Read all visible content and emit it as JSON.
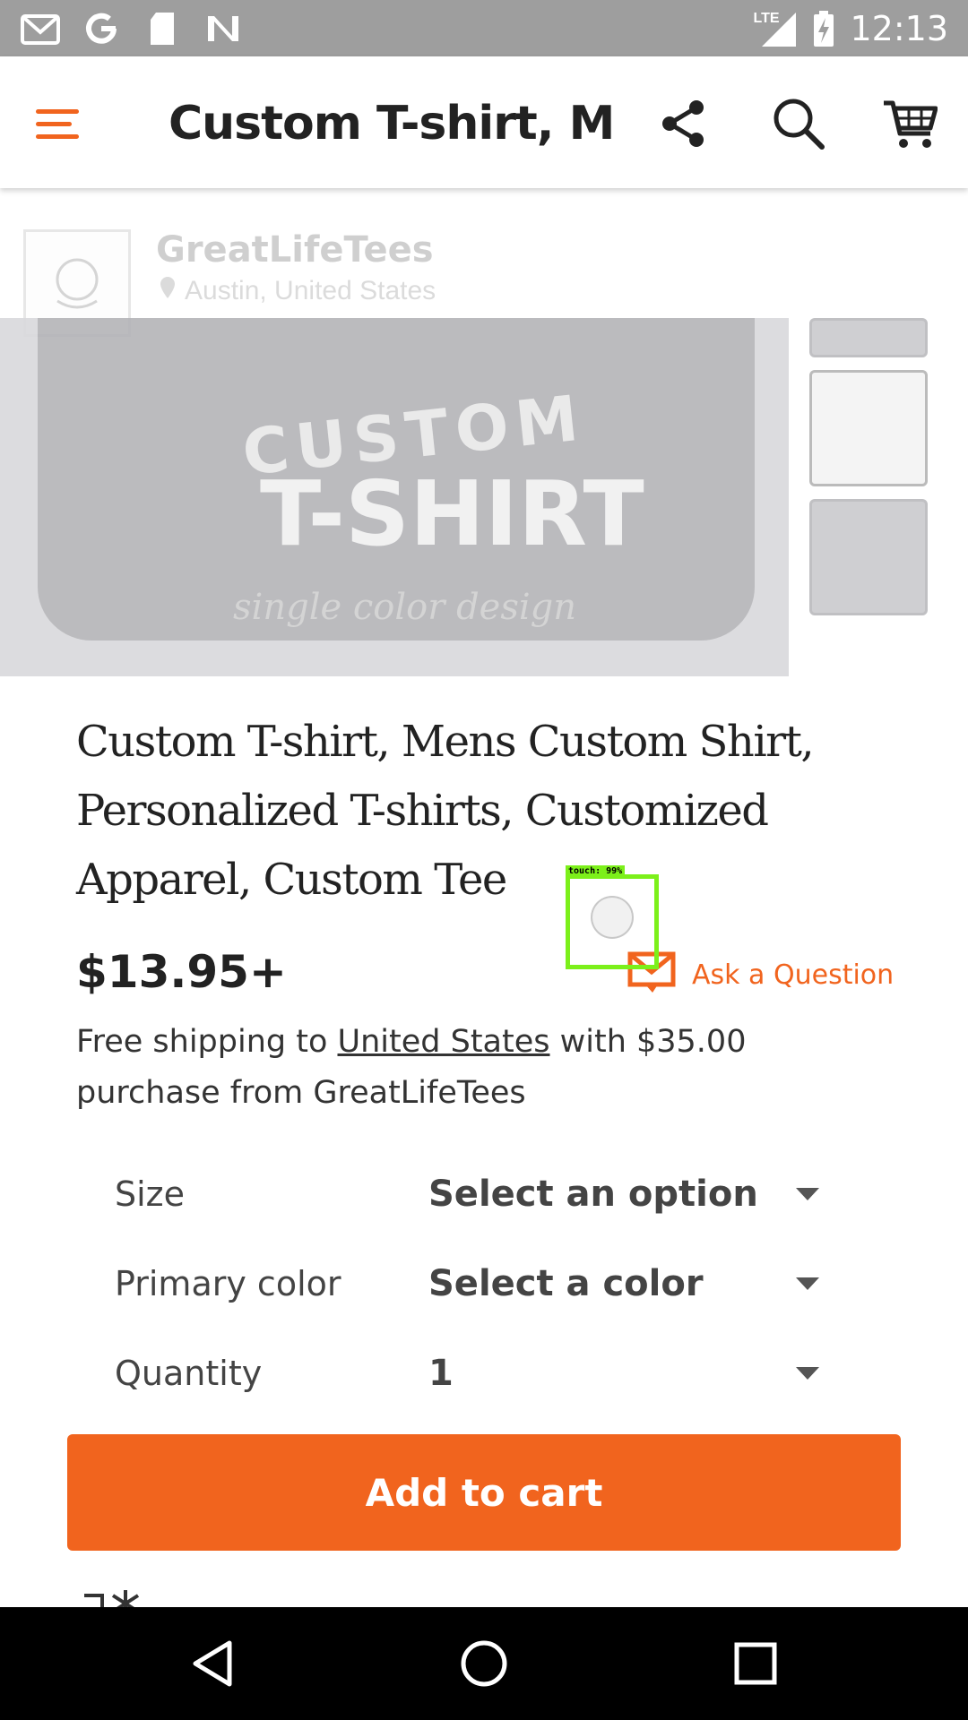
{
  "status_bar": {
    "time": "12:13",
    "network_label": "LTE",
    "icons": [
      "gmail-icon",
      "google-icon",
      "sd-card-icon",
      "n-app-icon",
      "signal-icon",
      "battery-charging-icon"
    ]
  },
  "app_bar": {
    "title": "Custom T-shirt, M...",
    "icons": [
      "menu-icon",
      "share-icon",
      "search-icon",
      "cart-icon"
    ]
  },
  "shop": {
    "name": "GreatLifeTees",
    "location": "Austin, United States"
  },
  "hero": {
    "shirt_line1": "CUSTOM",
    "shirt_line2": "T-SHIRT",
    "shirt_line3": "single color design"
  },
  "listing": {
    "title": "Custom T-shirt, Mens Custom Shirt, Personalized T-shirts, Customized Apparel, Custom Tee",
    "price": "$13.95+",
    "ask_question": "Ask a Question",
    "shipping_prefix": "Free shipping to ",
    "shipping_link": "United States",
    "shipping_suffix": " with $35.00 purchase from GreatLifeTees"
  },
  "options": [
    {
      "label": "Size",
      "value": "Select an option"
    },
    {
      "label": "Primary color",
      "value": "Select a color"
    },
    {
      "label": "Quantity",
      "value": "1"
    }
  ],
  "add_to_cart_label": "Add to cart",
  "touch_indicator": {
    "label": "touch: 99%"
  },
  "colors": {
    "accent": "#f1641e",
    "status_bar": "#9e9e9e",
    "touch_box": "#7cf01a"
  },
  "nav_bar": {
    "icons": [
      "back-icon",
      "home-icon",
      "recents-icon"
    ]
  }
}
